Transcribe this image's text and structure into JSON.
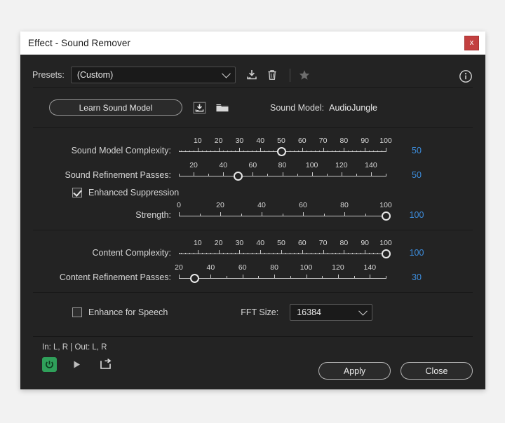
{
  "window": {
    "title": "Effect - Sound Remover",
    "close_label": "x"
  },
  "presets": {
    "label": "Presets:",
    "value": "(Custom)",
    "save_icon": "save-preset-icon",
    "delete_icon": "trash-icon",
    "favorite_icon": "star-icon",
    "info_icon": "info-icon"
  },
  "sound_model": {
    "learn_button": "Learn Sound Model",
    "save_icon": "save-model-icon",
    "open_icon": "folder-icon",
    "label": "Sound Model:",
    "value": "AudioJungle"
  },
  "sliders": [
    {
      "name": "sound-model-complexity",
      "label": "Sound Model Complexity:",
      "value": "50",
      "min": 1,
      "max": 100,
      "current": 50,
      "tick_labels": [
        "10",
        "20",
        "30",
        "40",
        "50",
        "60",
        "70",
        "80",
        "90",
        "100"
      ],
      "tick_values": [
        10,
        20,
        30,
        40,
        50,
        60,
        70,
        80,
        90,
        100
      ],
      "minor_step": 2,
      "dense": true
    },
    {
      "name": "sound-refinement-passes",
      "label": "Sound Refinement Passes:",
      "value": "50",
      "min": 10,
      "max": 150,
      "current": 50,
      "tick_labels": [
        "20",
        "40",
        "60",
        "80",
        "100",
        "120",
        "140"
      ],
      "tick_values": [
        20,
        40,
        60,
        80,
        100,
        120,
        140
      ],
      "minor_step": 10,
      "dense": false
    },
    {
      "name": "strength",
      "label": "Strength:",
      "value": "100",
      "min": 0,
      "max": 100,
      "current": 100,
      "tick_labels": [
        "0",
        "20",
        "40",
        "60",
        "80",
        "100"
      ],
      "tick_values": [
        0,
        20,
        40,
        60,
        80,
        100
      ],
      "minor_step": 10,
      "dense": false
    },
    {
      "name": "content-complexity",
      "label": "Content Complexity:",
      "value": "100",
      "min": 1,
      "max": 100,
      "current": 100,
      "tick_labels": [
        "10",
        "20",
        "30",
        "40",
        "50",
        "60",
        "70",
        "80",
        "90",
        "100"
      ],
      "tick_values": [
        10,
        20,
        30,
        40,
        50,
        60,
        70,
        80,
        90,
        100
      ],
      "minor_step": 2,
      "dense": true
    },
    {
      "name": "content-refinement-passes",
      "label": "Content Refinement Passes:",
      "value": "30",
      "min": 20,
      "max": 150,
      "current": 30,
      "tick_labels": [
        "20",
        "40",
        "60",
        "80",
        "100",
        "120",
        "140"
      ],
      "tick_values": [
        20,
        40,
        60,
        80,
        100,
        120,
        140
      ],
      "minor_step": 10,
      "dense": false
    }
  ],
  "checkboxes": {
    "enhanced_suppression": {
      "label": "Enhanced Suppression",
      "checked": true
    },
    "enhance_for_speech": {
      "label": "Enhance for Speech",
      "checked": false
    }
  },
  "fft": {
    "label": "FFT Size:",
    "value": "16384"
  },
  "footer": {
    "io_text": "In: L, R | Out: L, R",
    "power_icon": "power-icon",
    "play_icon": "play-icon",
    "loop_icon": "loop-icon",
    "apply_label": "Apply",
    "close_label": "Close"
  },
  "colors": {
    "accent_blue": "#3d8ede",
    "power_green": "#2fa05a",
    "close_red": "#c34040",
    "window_bg": "#232323",
    "titlebar_bg": "#ffffff"
  }
}
